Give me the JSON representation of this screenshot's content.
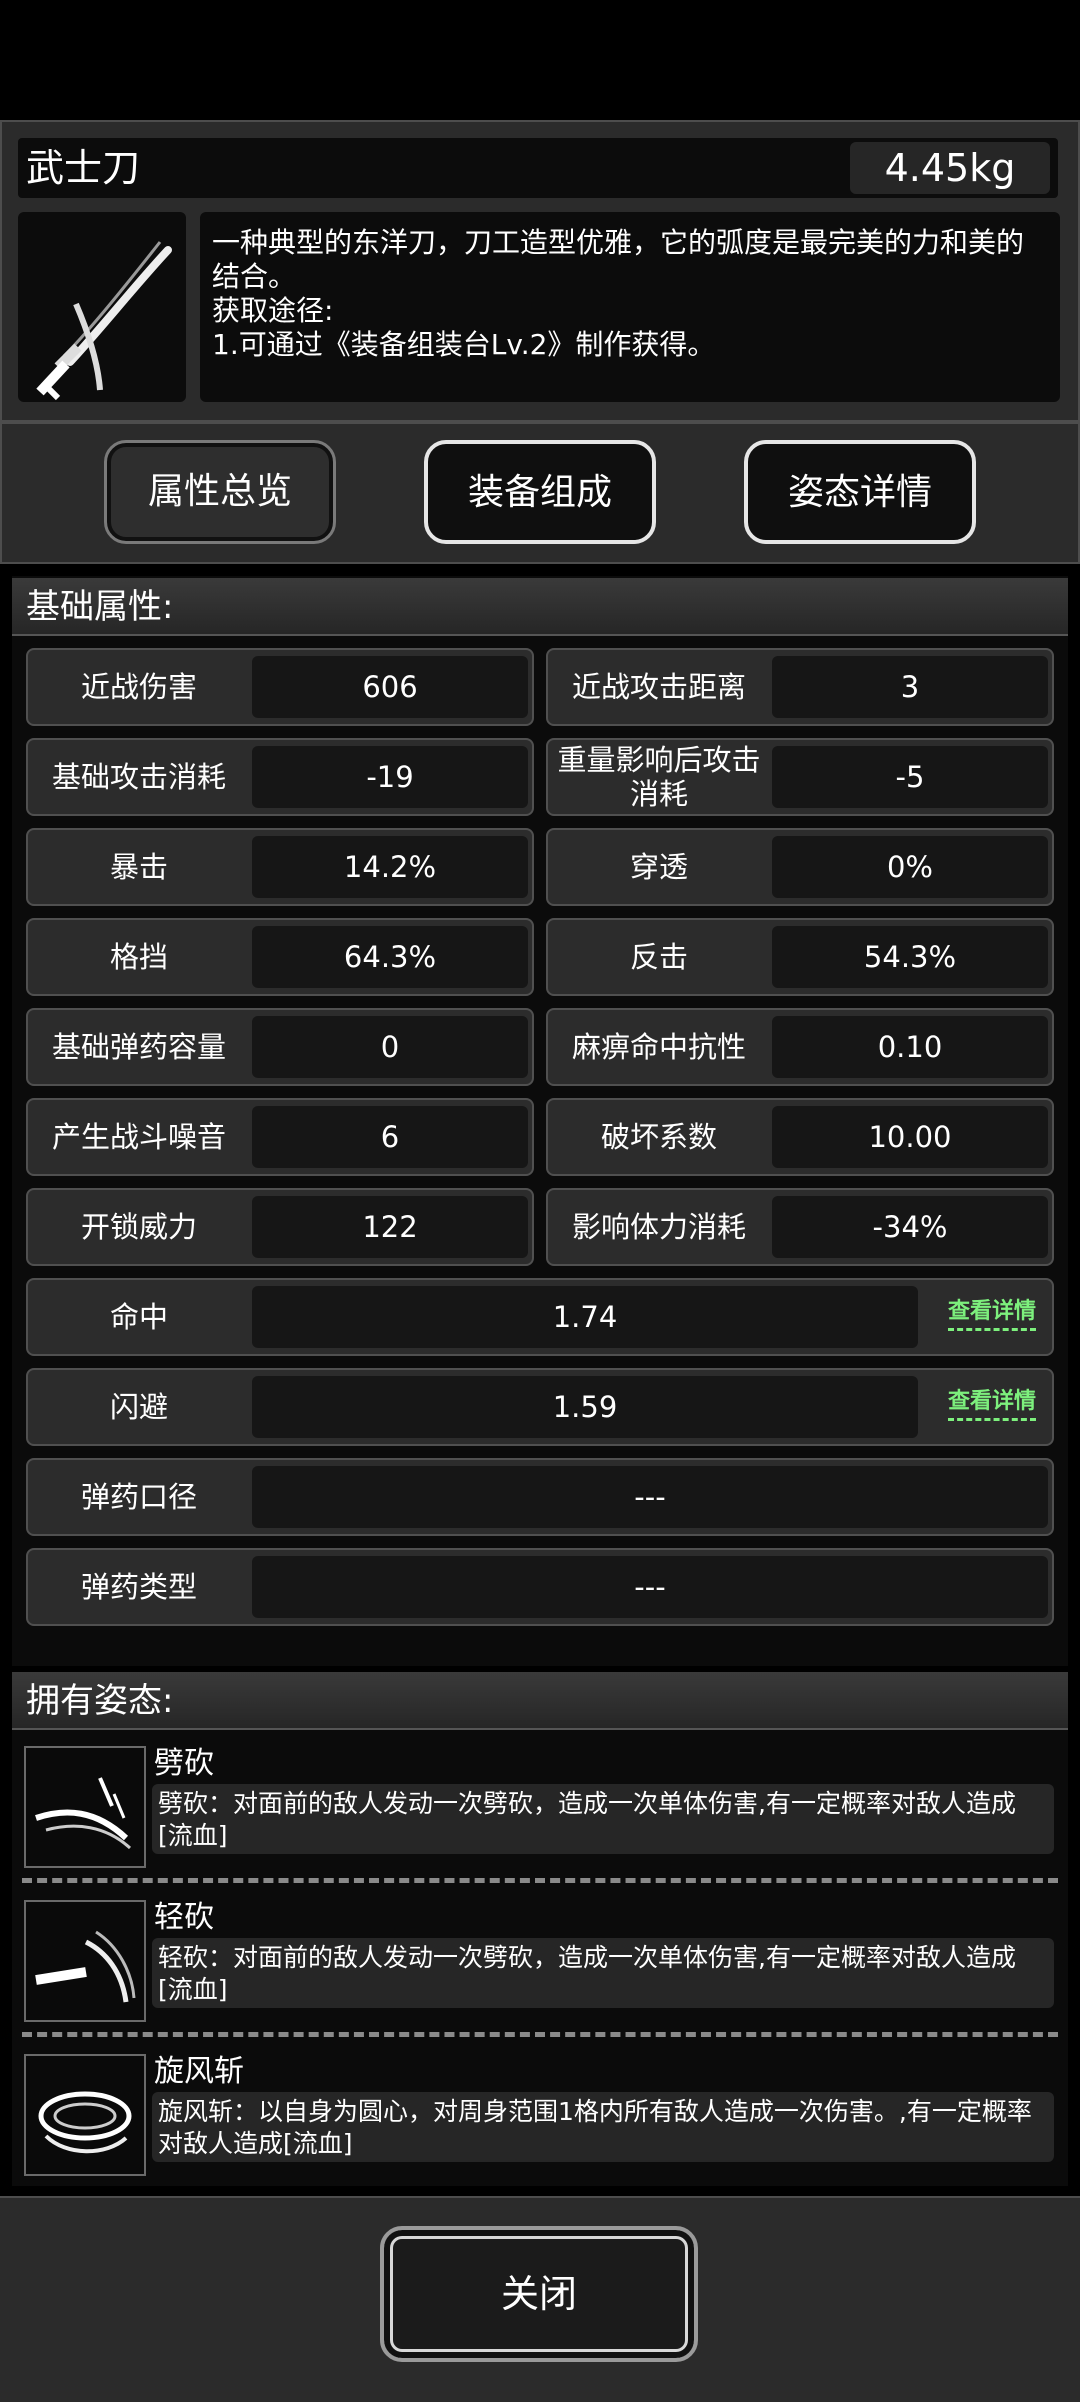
{
  "item": {
    "name": "武士刀",
    "weight": "4.45kg",
    "description": "一种典型的东洋刀，刀工造型优雅，它的弧度是最完美的力和美的结合。\n获取途径:\n1.可通过《装备组装台Lv.2》制作获得。",
    "icon": "katana-icon"
  },
  "tabs": [
    {
      "label": "属性总览",
      "active": true
    },
    {
      "label": "装备组成"
    },
    {
      "label": "姿态详情"
    }
  ],
  "attributes": {
    "title": "基础属性:",
    "pairs": [
      {
        "l_label": "近战伤害",
        "l_value": "606",
        "r_label": "近战攻击距离",
        "r_value": "3"
      },
      {
        "l_label": "基础攻击消耗",
        "l_value": "-19",
        "r_label": "重量影响后攻击消耗",
        "r_value": "-5"
      },
      {
        "l_label": "暴击",
        "l_value": "14.2%",
        "r_label": "穿透",
        "r_value": "0%"
      },
      {
        "l_label": "格挡",
        "l_value": "64.3%",
        "r_label": "反击",
        "r_value": "54.3%"
      },
      {
        "l_label": "基础弹药容量",
        "l_value": "0",
        "r_label": "麻痹命中抗性",
        "r_value": "0.10"
      },
      {
        "l_label": "产生战斗噪音",
        "l_value": "6",
        "r_label": "破坏系数",
        "r_value": "10.00"
      },
      {
        "l_label": "开锁威力",
        "l_value": "122",
        "r_label": "影响体力消耗",
        "r_value": "-34%"
      }
    ],
    "wide": [
      {
        "label": "命中",
        "value": "1.74",
        "link": "查看详情"
      },
      {
        "label": "闪避",
        "value": "1.59",
        "link": "查看详情"
      },
      {
        "label": "弹药口径",
        "value": "---"
      },
      {
        "label": "弹药类型",
        "value": "---"
      }
    ]
  },
  "stances": {
    "title": "拥有姿态:",
    "items": [
      {
        "name": "劈砍",
        "desc": "劈砍：对面前的敌人发动一次劈砍，造成一次单体伤害,有一定概率对敌人造成[流血]",
        "icon": "slash-icon"
      },
      {
        "name": "轻砍",
        "desc": "轻砍：对面前的敌人发动一次劈砍，造成一次单体伤害,有一定概率对敌人造成[流血]",
        "icon": "light-slash-icon"
      },
      {
        "name": "旋风斩",
        "desc": "旋风斩：以自身为圆心，对周身范围1格内所有敌人造成一次伤害。,有一定概率对敌人造成[流血]",
        "icon": "whirlwind-icon"
      }
    ]
  },
  "footer": {
    "close_label": "关闭"
  }
}
